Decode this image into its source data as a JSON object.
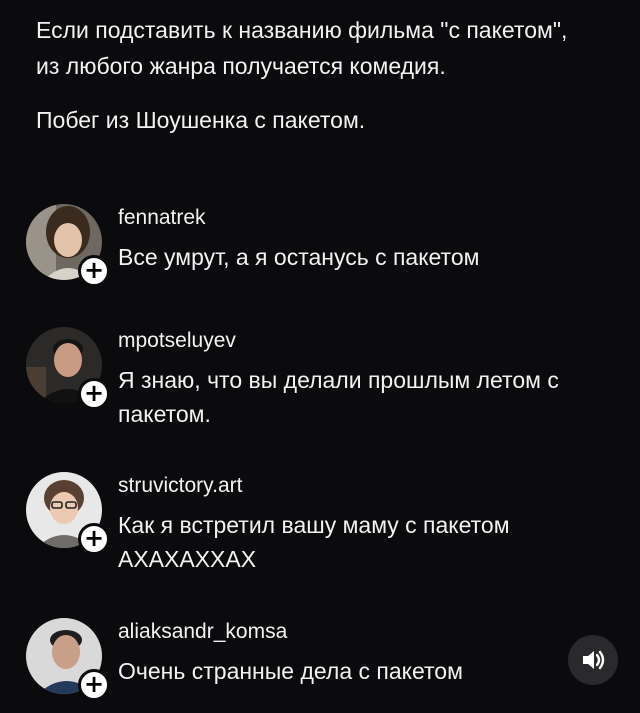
{
  "post": {
    "paragraph_1": "Если подставить к названию фильма \"с пакетом\", из любого жанра получается комедия.",
    "paragraph_2": "Побег из Шоушенка с пакетом."
  },
  "comments": [
    {
      "username": "fennatrek",
      "text": "Все умрут, а я останусь с пакетом"
    },
    {
      "username": "mpotseluyev",
      "text": "Я знаю, что вы делали прошлым летом с пакетом."
    },
    {
      "username": "struvictory.art",
      "text": "Как я встретил вашу маму с пакетом АХАХАХХАХ"
    },
    {
      "username": "aliaksandr_komsa",
      "text": "Очень странные дела с пакетом"
    }
  ],
  "badge_symbol": "+",
  "icons": {
    "follow": "plus-icon",
    "sound": "speaker-icon"
  },
  "colors": {
    "background": "#0b0b0d",
    "text": "#f2f2f2",
    "sound_button": "#2a2a2c"
  }
}
